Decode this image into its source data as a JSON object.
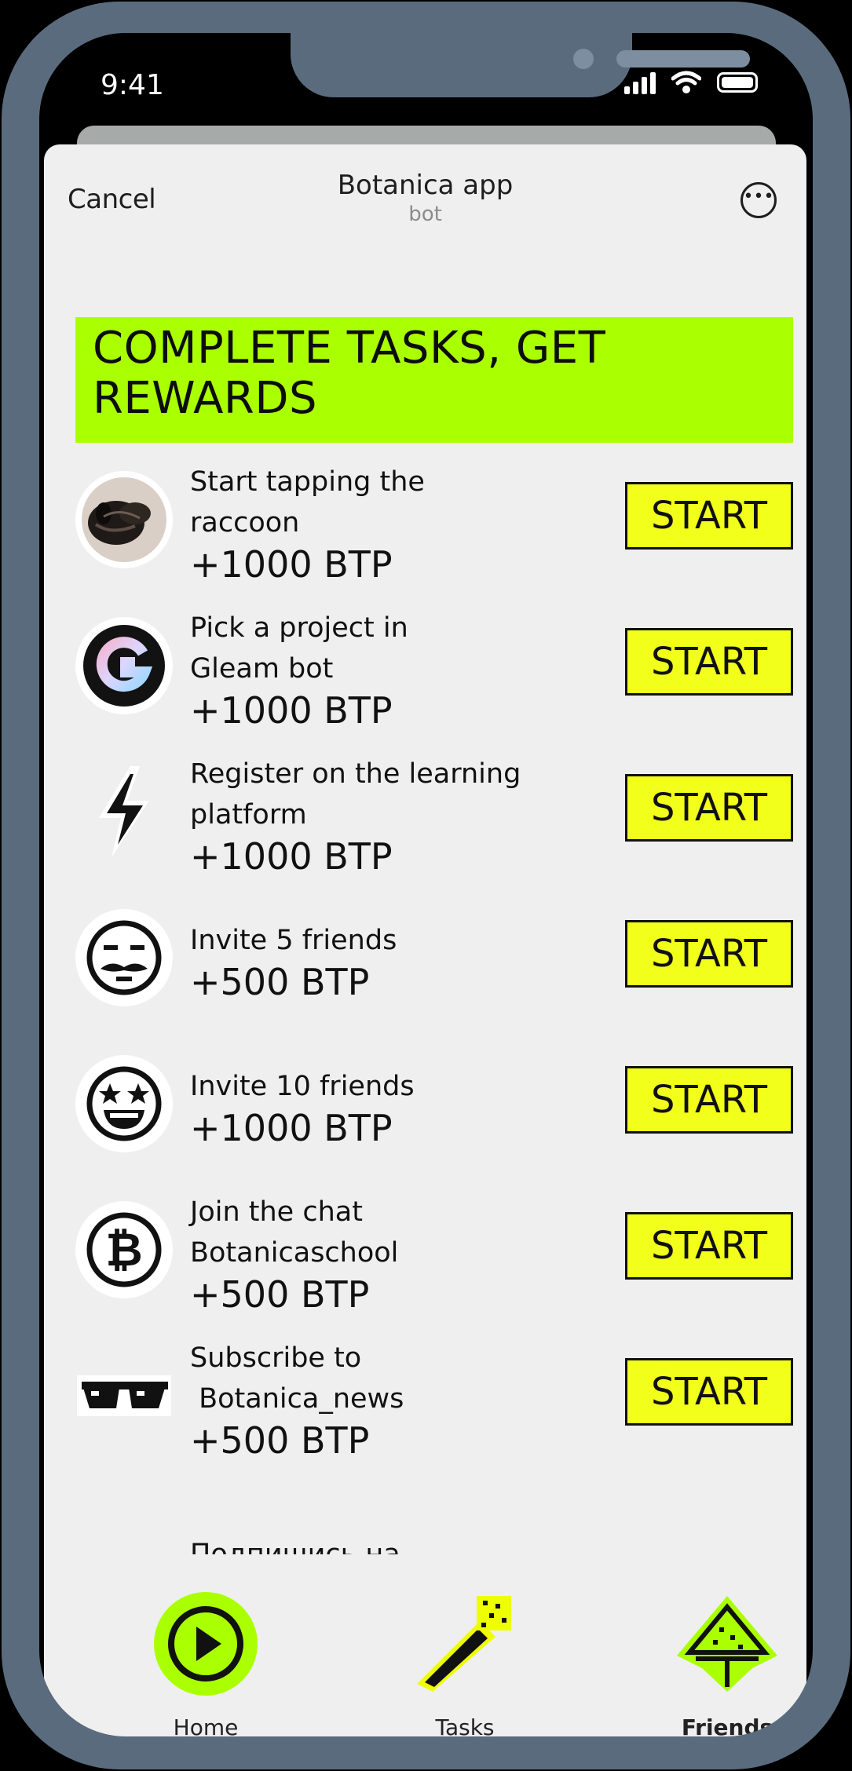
{
  "status_bar": {
    "time": "9:41"
  },
  "header": {
    "cancel": "Cancel",
    "title": "Botanica app",
    "subtitle": "bot",
    "more_icon": "ellipsis-circle-icon"
  },
  "banner": {
    "text": "COMPLETE TASKS, GET REWARDS"
  },
  "tasks": [
    {
      "title_1": "Start tapping the",
      "title_2": "raccoon",
      "reward": "+1000 BTP",
      "button": "START",
      "icon": "raccoon-avatar-icon"
    },
    {
      "title_1": "Pick a project in",
      "title_2": "Gleam bot",
      "reward": "+1000 BTP",
      "button": "START",
      "icon": "gleam-logo-icon"
    },
    {
      "title_1": "Register on the learning",
      "title_2": "platform",
      "reward": "+1000 BTP",
      "button": "START",
      "icon": "lightning-icon"
    },
    {
      "title_1": "Invite 5 friends",
      "reward": "+500 BTP",
      "button": "START",
      "icon": "mustache-face-icon"
    },
    {
      "title_1": "Invite 10 friends",
      "reward": "+1000 BTP",
      "button": "START",
      "icon": "star-eyes-face-icon"
    },
    {
      "title_1": "Join the chat",
      "title_2": "Botanicaschool",
      "reward": "+500 BTP",
      "button": "START",
      "icon": "bitcoin-coin-icon"
    },
    {
      "title_1": "Subscribe to",
      "title_2": " Botanica_news",
      "reward": "+500 BTP",
      "button": "START",
      "icon": "sunglasses-icon"
    }
  ],
  "peek_text": "Подпишись на",
  "nav": [
    {
      "label": "Home",
      "icon": "play-circle-icon"
    },
    {
      "label": "Tasks",
      "icon": "magic-wand-icon"
    },
    {
      "label": "Friends",
      "icon": "tent-icon"
    }
  ],
  "colors": {
    "accent": "#aaff00",
    "button": "#f2ff1a",
    "frame": "#5b6b7e",
    "background": "#efefef"
  }
}
